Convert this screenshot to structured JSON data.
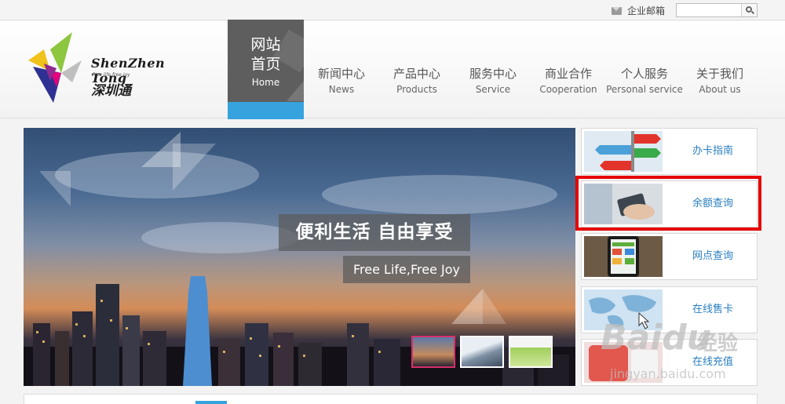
{
  "topbar": {
    "mail_label": "企业邮箱",
    "search_placeholder": ""
  },
  "logo": {
    "name_en": "ShenZhen Tong",
    "tagline": "free life free joy",
    "name_cn": "深圳通"
  },
  "nav": {
    "home": {
      "cn_line1": "网站",
      "cn_line2": "首页",
      "en": "Home"
    },
    "items": [
      {
        "cn": "新闻中心",
        "en": "News"
      },
      {
        "cn": "产品中心",
        "en": "Products"
      },
      {
        "cn": "服务中心",
        "en": "Service"
      },
      {
        "cn": "商业合作",
        "en": "Cooperation"
      },
      {
        "cn": "个人服务",
        "en": "Personal service"
      },
      {
        "cn": "关于我们",
        "en": "About us"
      }
    ]
  },
  "banner": {
    "slogan_cn": "便利生活 自由享受",
    "slogan_en": "Free Life,Free Joy",
    "active_thumb": 0
  },
  "side_links": [
    {
      "label": "办卡指南"
    },
    {
      "label": "余额查询"
    },
    {
      "label": "网点查询"
    },
    {
      "label": "在线售卡"
    },
    {
      "label": "在线充值"
    }
  ],
  "highlight_target": "余额查询",
  "watermark": {
    "brand": "Baidu",
    "cn": "经验",
    "url": "jingyan.baidu.com"
  },
  "colors": {
    "accent_blue": "#36a3de",
    "link_blue": "#2a7fc1",
    "highlight_red": "#e60000"
  }
}
